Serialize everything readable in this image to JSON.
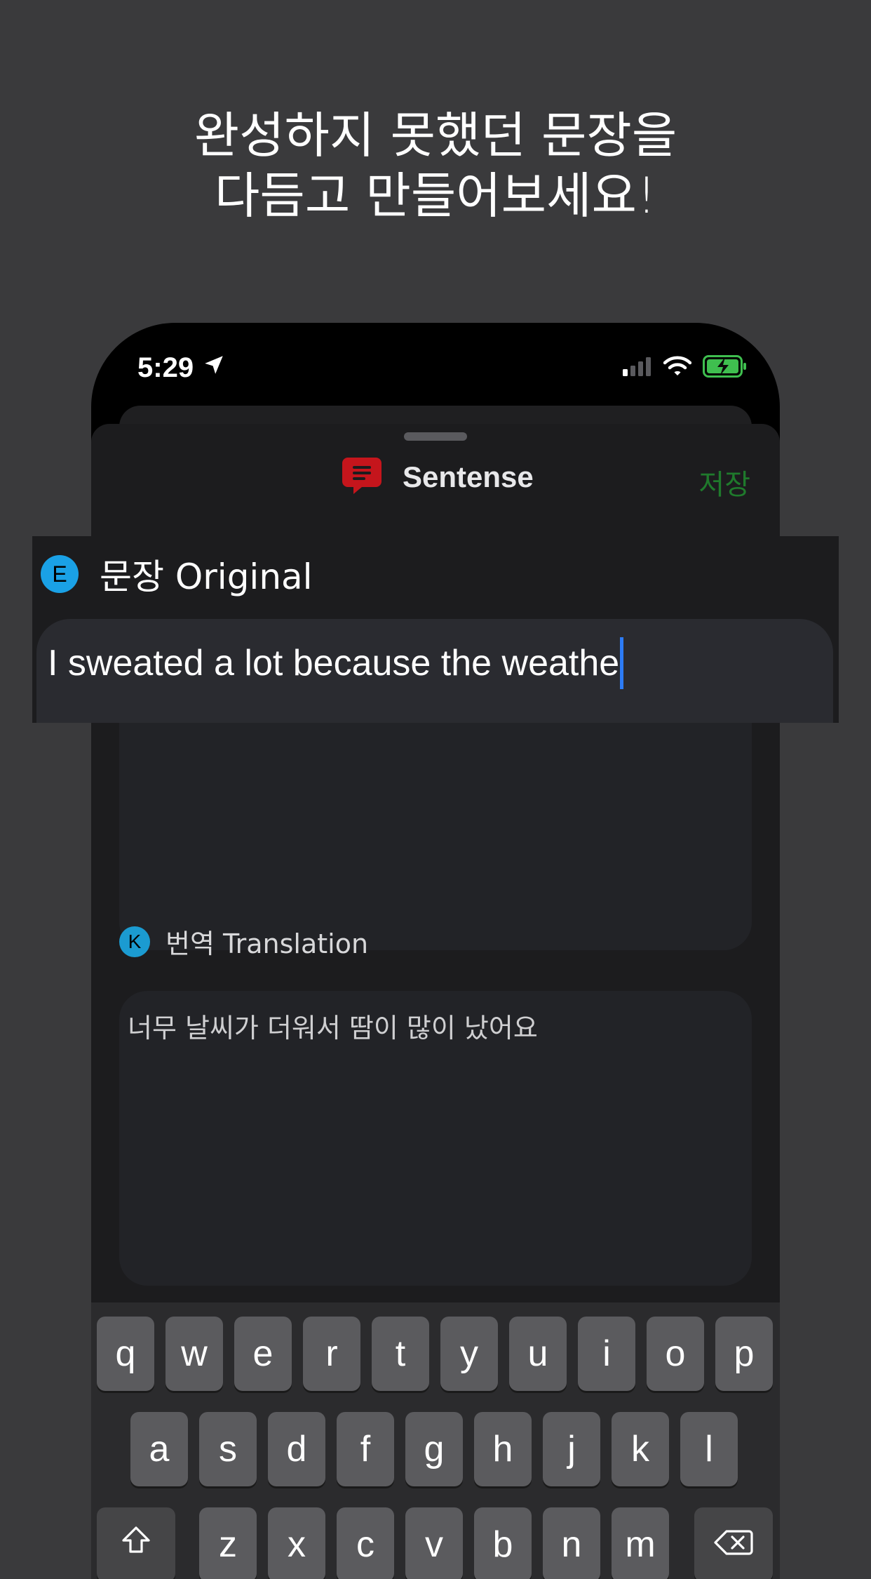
{
  "headline": {
    "line1": "완성하지 못했던 문장을",
    "line2": "다듬고 만들어보세요!"
  },
  "status_bar": {
    "time": "5:29",
    "icons": [
      "location-arrow-icon",
      "cellular-signal-icon",
      "wifi-icon",
      "battery-charging-icon"
    ]
  },
  "nav": {
    "title": "Sentense",
    "save_label": "저장",
    "logo_icon": "chat-bubble-icon",
    "accent_color": "#1f7a2c",
    "logo_color": "#c5151c"
  },
  "original": {
    "badge": "E",
    "label": "문장 Original",
    "value": "I sweated a lot because the weathe",
    "badge_color": "#1aa1e6"
  },
  "translation": {
    "badge": "K",
    "label": "번역 Translation",
    "value": "너무 날씨가 더워서 땀이 많이 났어요",
    "badge_color": "#1b9bd1"
  },
  "keyboard": {
    "row1": [
      "q",
      "w",
      "e",
      "r",
      "t",
      "y",
      "u",
      "i",
      "o",
      "p"
    ],
    "row2": [
      "a",
      "s",
      "d",
      "f",
      "g",
      "h",
      "j",
      "k",
      "l"
    ],
    "row3": [
      "z",
      "x",
      "c",
      "v",
      "b",
      "n",
      "m"
    ],
    "shift_icon": "shift-icon",
    "delete_icon": "backspace-icon"
  }
}
